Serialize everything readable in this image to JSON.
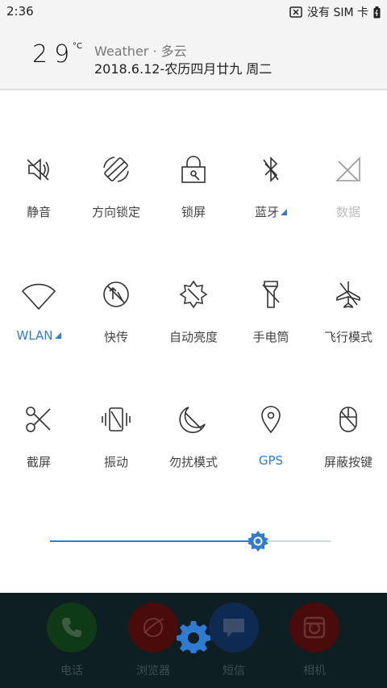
{
  "status": {
    "time": "2:36",
    "carrier": "没有 SIM 卡"
  },
  "header": {
    "temperature": "29",
    "unit": "°C",
    "weather": "Weather · 多云",
    "date": "2018.6.12-农历四月廿九 周二"
  },
  "tiles": [
    {
      "label": "静音",
      "icon": "mute-icon",
      "state": "normal"
    },
    {
      "label": "方向锁定",
      "icon": "rotation-lock-icon",
      "state": "normal"
    },
    {
      "label": "锁屏",
      "icon": "lock-screen-icon",
      "state": "normal"
    },
    {
      "label": "蓝牙",
      "icon": "bluetooth-icon",
      "state": "normal",
      "expandable": true
    },
    {
      "label": "数据",
      "icon": "mobile-data-icon",
      "state": "disabled"
    },
    {
      "label": "WLAN",
      "icon": "wifi-icon",
      "state": "active",
      "expandable": true
    },
    {
      "label": "快传",
      "icon": "quick-transfer-icon",
      "state": "normal"
    },
    {
      "label": "自动亮度",
      "icon": "auto-brightness-icon",
      "state": "normal"
    },
    {
      "label": "手电筒",
      "icon": "flashlight-icon",
      "state": "normal"
    },
    {
      "label": "飞行模式",
      "icon": "airplane-icon",
      "state": "normal"
    },
    {
      "label": "截屏",
      "icon": "screenshot-icon",
      "state": "normal"
    },
    {
      "label": "振动",
      "icon": "vibrate-icon",
      "state": "normal"
    },
    {
      "label": "勿扰模式",
      "icon": "do-not-disturb-icon",
      "state": "normal"
    },
    {
      "label": "GPS",
      "icon": "gps-icon",
      "state": "active"
    },
    {
      "label": "屏蔽按键",
      "icon": "block-keys-icon",
      "state": "normal"
    }
  ],
  "brightness": {
    "value": 0.74
  },
  "dock": [
    {
      "label": "电话",
      "icon": "phone-icon",
      "color": "#0f3a17"
    },
    {
      "label": "浏览器",
      "icon": "browser-icon",
      "color": "#4a0b0b"
    },
    {
      "label": "短信",
      "icon": "message-icon",
      "color": "#0f2a52"
    },
    {
      "label": "相机",
      "icon": "camera-icon",
      "color": "#4a0b0b"
    }
  ],
  "colors": {
    "accent": "#2e7bd1",
    "icon_stroke": "#333333",
    "disabled": "#bdbdbd"
  }
}
